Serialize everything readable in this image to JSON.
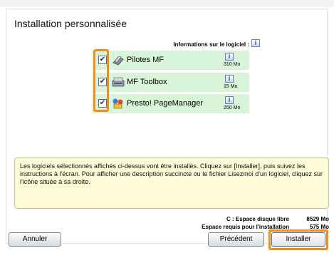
{
  "title": "Installation personnalisée",
  "info_label": "Informations sur le logiciel :",
  "info_icon": "info-i-icon",
  "software": [
    {
      "name": "Pilotes MF",
      "size": "310 Mo",
      "checked": true,
      "icon": "printer-driver-icon"
    },
    {
      "name": "MF Toolbox",
      "size": "15 Mo",
      "checked": true,
      "icon": "scanner-toolbox-icon"
    },
    {
      "name": "Presto! PageManager",
      "size": "250 Mo",
      "checked": true,
      "icon": "page-manager-icon"
    }
  ],
  "description": "Les logiciels sélectionnés affichés ci-dessus vont être installés. Cliquez sur [Installer], puis suivez les instructions à l'écran. Pour afficher une description succincte ou le fichier Lisezmoi d'un logiciel, cliquez sur l'icône située à sa droite.",
  "disk": {
    "free_label": "C : Espace disque libre",
    "free_value": "8529 Mo",
    "required_label": "Espace requis pour l'installation",
    "required_value": "575 Mo"
  },
  "buttons": {
    "cancel": "Annuler",
    "previous": "Précédent",
    "install": "Installer"
  },
  "colors": {
    "highlight": "#f28c1a",
    "row_bg": "#d9f5d9",
    "description_bg": "#fdfad8"
  }
}
